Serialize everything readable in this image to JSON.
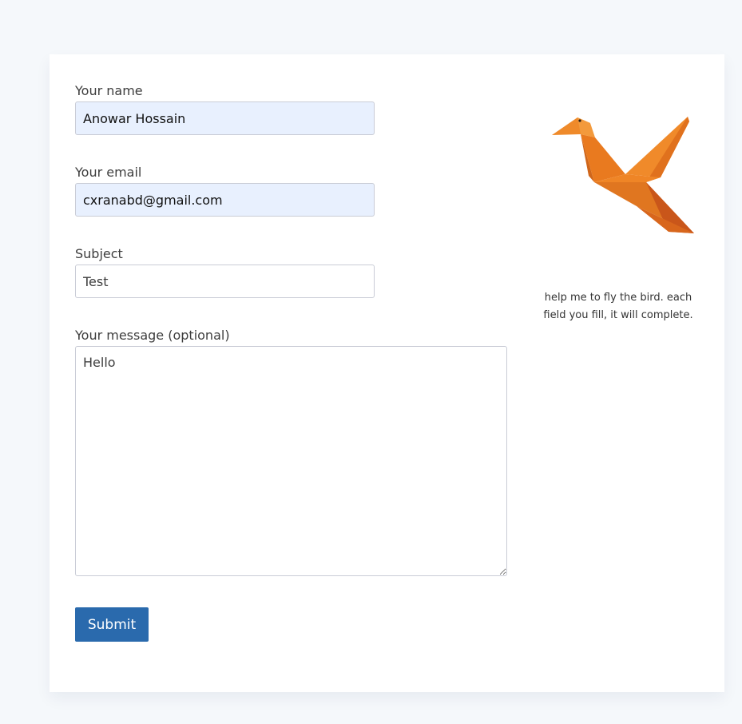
{
  "form": {
    "name": {
      "label": "Your name",
      "value": "Anowar Hossain"
    },
    "email": {
      "label": "Your email",
      "value": "cxranabd@gmail.com"
    },
    "subject": {
      "label": "Subject",
      "value": "Test"
    },
    "message": {
      "label": "Your message (optional)",
      "value": "Hello"
    },
    "submit_label": "Submit"
  },
  "sidebar": {
    "illustration_icon": "origami-bird-icon",
    "caption": "help me to fly the bird. each field you fill, it will complete."
  },
  "colors": {
    "accent": "#2a6aad",
    "autofill_bg": "#e8f0fe",
    "bird": "#ef7f22"
  }
}
